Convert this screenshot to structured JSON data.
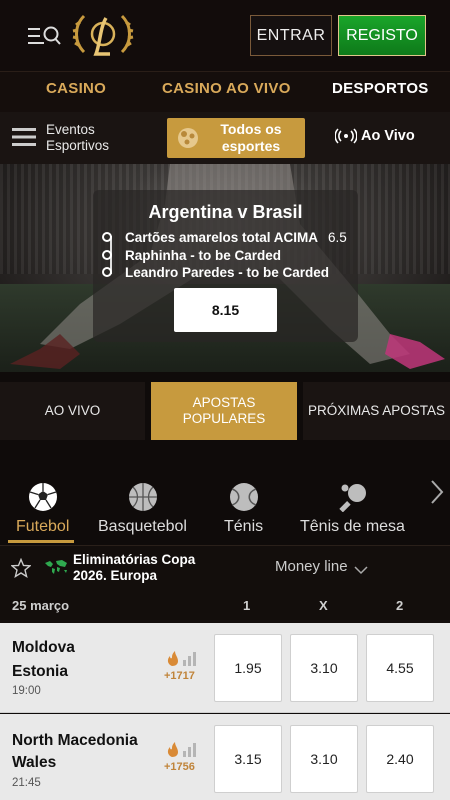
{
  "header": {
    "entrar_label": "ENTRAR",
    "registo_label": "REGISTO"
  },
  "nav": {
    "casino": "CASINO",
    "casino_ao_vivo": "CASINO AO VIVO",
    "desportos": "DESPORTOS"
  },
  "subnav": {
    "eventos_line1": "Eventos",
    "eventos_line2": "Esportivos",
    "todos_line1": "Todos os",
    "todos_line2": "esportes",
    "ao_vivo": "Ao Vivo"
  },
  "banner": {
    "match": "Argentina  v  Brasil",
    "selections": [
      {
        "label": "Cartões amarelos total ACIMA",
        "value": "6.5"
      },
      {
        "label": "Raphinha - to be Carded",
        "value": ""
      },
      {
        "label": "Leandro Paredes - to be Carded",
        "value": ""
      }
    ],
    "odds": "8.15"
  },
  "tabs": {
    "ao_vivo": "AO VIVO",
    "populares_line1": "APOSTAS",
    "populares_line2": "POPULARES",
    "proximas": "PRÓXIMAS APOSTAS"
  },
  "sports": [
    {
      "label": "Futebol",
      "icon": "football-icon"
    },
    {
      "label": "Basquetebol",
      "icon": "basketball-icon"
    },
    {
      "label": "Ténis",
      "icon": "tennis-icon"
    },
    {
      "label": "Tênis de mesa",
      "icon": "table-tennis-icon"
    }
  ],
  "league": {
    "name_line1": "Eliminatórias Copa",
    "name_line2": "2026. Europa",
    "market": "Money line"
  },
  "columns": {
    "date": "25 março",
    "c1": "1",
    "cx": "X",
    "c2": "2"
  },
  "matches": [
    {
      "home": "Moldova",
      "away": "Estonia",
      "time": "19:00",
      "markets": "+1717",
      "odds": [
        "1.95",
        "3.10",
        "4.55"
      ]
    },
    {
      "home": "North Macedonia",
      "away": "Wales",
      "time": "21:45",
      "markets": "+1756",
      "odds": [
        "3.15",
        "3.10",
        "2.40"
      ]
    }
  ],
  "colors": {
    "accent_gold": "#c79a3e",
    "register_green": "#1aa52a",
    "market_count": "#c0843a"
  }
}
